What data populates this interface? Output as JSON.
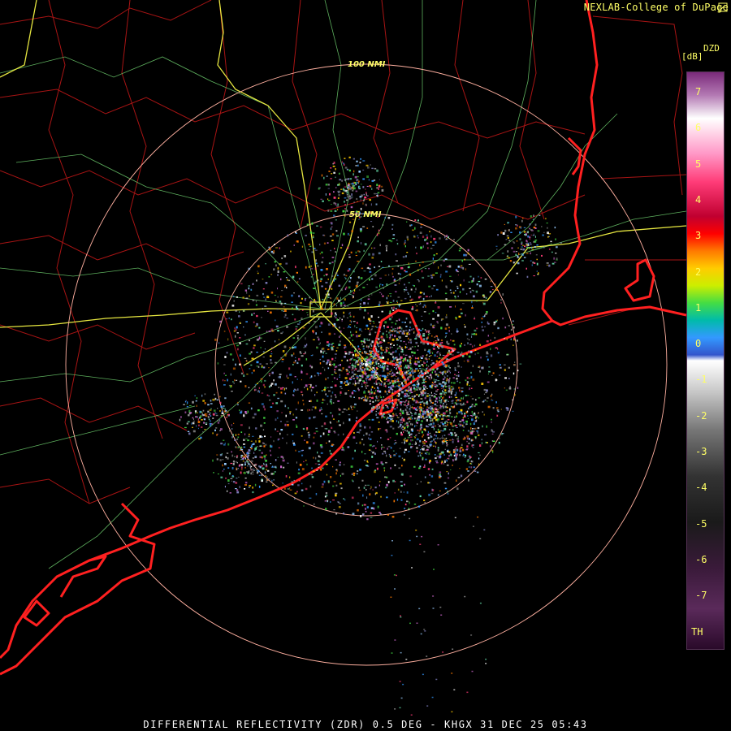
{
  "credit": "NEXLAB-College of DuPage",
  "footer": "DIFFERENTIAL REFLECTIVITY (ZDR) 0.5 DEG - KHGX 31 DEC 25 05:43",
  "colorbar": {
    "title": "DZD",
    "unit": "[dB]",
    "labels": [
      "7",
      "6",
      "5",
      "4",
      "3",
      "2",
      "1",
      "0",
      "-1",
      "-2",
      "-3",
      "-4",
      "-5",
      "-6",
      "-7",
      "TH"
    ]
  },
  "range_rings": {
    "inner_label": "50 NMI",
    "outer_label": "100 NMI"
  },
  "colors": {
    "coastline": "#ff2020",
    "county_lines": "#aa1111",
    "highways": "#e6e640",
    "roads": "#88dd88",
    "range_rings": "#ffb0a0"
  },
  "icons": [
    "radar-site-icon",
    "corner-logo-icon"
  ]
}
